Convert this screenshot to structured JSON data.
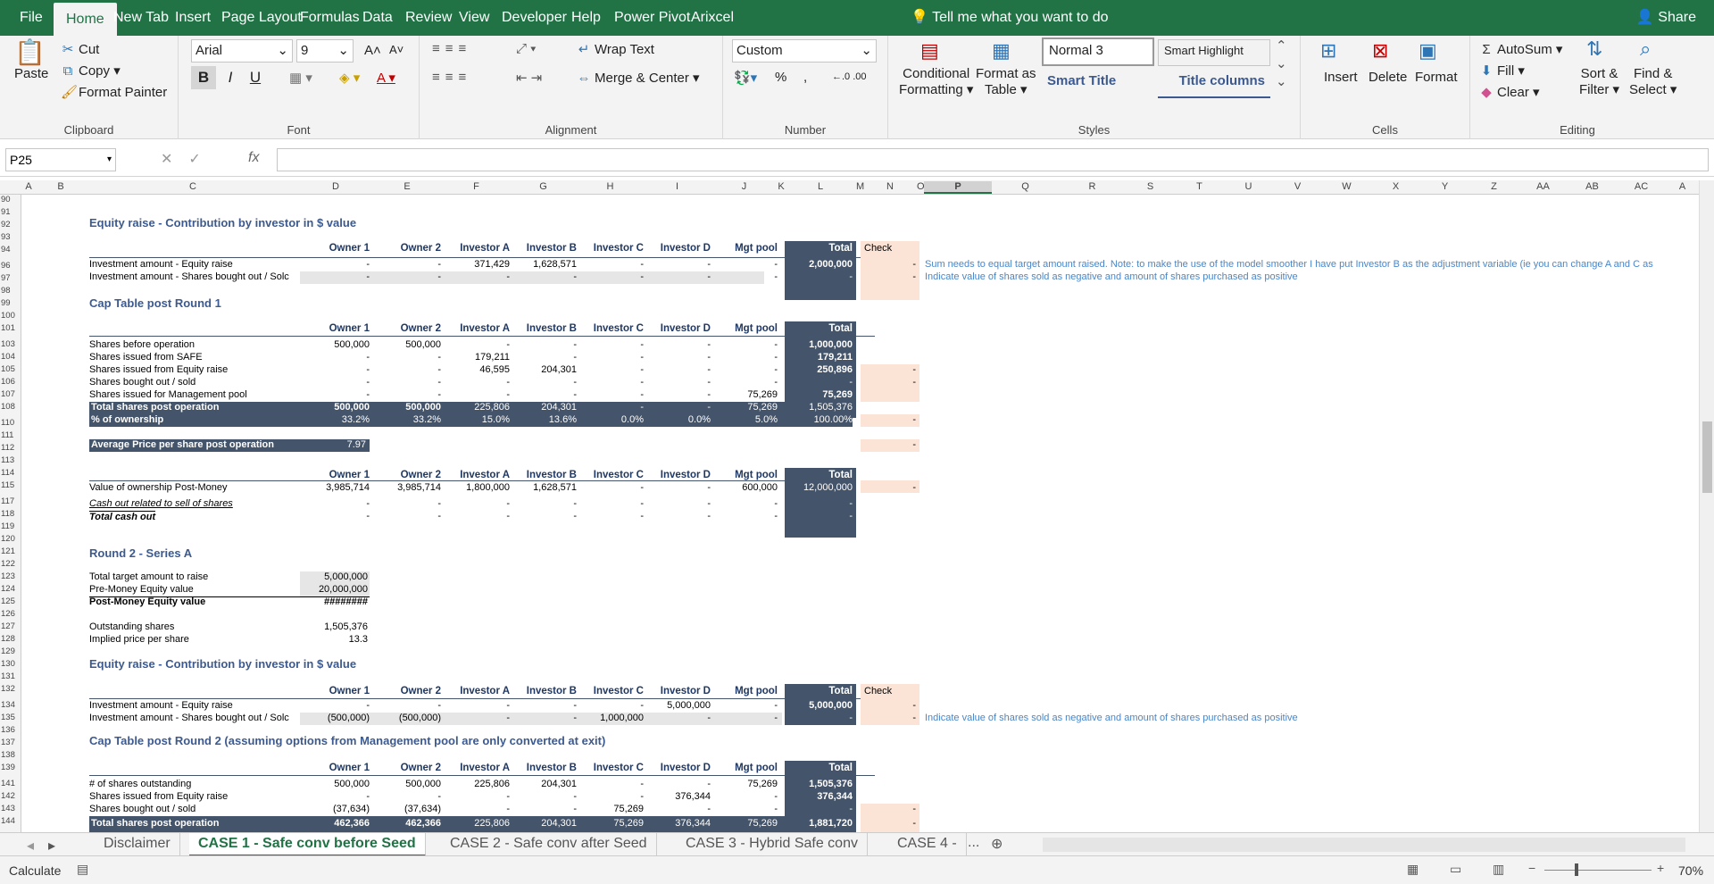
{
  "menubar": {
    "file": "File",
    "tabs": [
      "Home",
      "New Tab",
      "Insert",
      "Page Layout",
      "Formulas",
      "Data",
      "Review",
      "View",
      "Developer",
      "Help",
      "Power Pivot",
      "Arixcel"
    ],
    "tell_me": "Tell me what you want to do",
    "share": "Share"
  },
  "ribbon": {
    "clipboard": {
      "paste": "Paste",
      "cut": "Cut",
      "copy": "Copy",
      "format_painter": "Format Painter",
      "label": "Clipboard"
    },
    "font": {
      "name": "Arial",
      "size": "9",
      "label": "Font",
      "bold": "B",
      "italic": "I",
      "underline": "U"
    },
    "alignment": {
      "wrap": "Wrap Text",
      "merge": "Merge & Center",
      "label": "Alignment"
    },
    "number": {
      "format": "Custom",
      "percent": "%",
      "comma": ",",
      "label": "Number"
    },
    "styles": {
      "conditional": "Conditional",
      "conditional2": "Formatting",
      "format_as": "Format as",
      "format_as2": "Table",
      "normal3": "Normal 3",
      "smart_highlight": "Smart Highlight",
      "smart_title": "Smart Title",
      "title_columns": "Title columns",
      "label": "Styles"
    },
    "cells": {
      "insert": "Insert",
      "delete": "Delete",
      "format": "Format",
      "label": "Cells"
    },
    "editing": {
      "autosum": "AutoSum",
      "fill": "Fill",
      "clear": "Clear",
      "sort": "Sort &",
      "sort2": "Filter",
      "find": "Find &",
      "find2": "Select",
      "label": "Editing"
    }
  },
  "formula_bar": {
    "name_box": "P25",
    "fx": "fx",
    "value": ""
  },
  "columns": [
    "A",
    "B",
    "C",
    "D",
    "E",
    "F",
    "G",
    "H",
    "I",
    "J",
    "K",
    "L",
    "M",
    "N",
    "O",
    "P",
    "Q",
    "R",
    "S",
    "T",
    "U",
    "V",
    "W",
    "X",
    "Y",
    "Z",
    "AA",
    "AB",
    "AC",
    "A"
  ],
  "rows": [
    "90",
    "91",
    "92",
    "93",
    "94",
    "96",
    "97",
    "98",
    "99",
    "100",
    "101",
    "103",
    "104",
    "105",
    "106",
    "107",
    "108",
    "110",
    "111",
    "112",
    "113",
    "114",
    "115",
    "117",
    "118",
    "119",
    "120",
    "121",
    "122",
    "123",
    "124",
    "125",
    "126",
    "127",
    "128",
    "129",
    "130",
    "131",
    "132",
    "134",
    "135",
    "136",
    "137",
    "138",
    "139",
    "141",
    "142",
    "143",
    "144"
  ],
  "sheet": {
    "sec1": "Equity raise - Contribution by investor in $ value",
    "headers": [
      "Owner 1",
      "Owner 2",
      "Investor A",
      "Investor B",
      "Investor C",
      "Investor D",
      "Mgt pool",
      "Total",
      "Check"
    ],
    "r96_label": "Investment amount - Equity raise",
    "r96": [
      "-",
      "-",
      "371,429",
      "1,628,571",
      "-",
      "-",
      "-",
      "2,000,000",
      "-"
    ],
    "r97_label": "Investment amount - Shares bought out / Solc",
    "r97": [
      "-",
      "-",
      "-",
      "-",
      "-",
      "-",
      "-",
      "-",
      "-"
    ],
    "note96": "Sum needs to equal target amount raised. Note: to make the use of the model smoother I have put Investor B as the adjustment variable (ie you can change A and C as",
    "note97": "Indicate value of shares sold as negative and amount of shares purchased as positive",
    "sec2": "Cap Table post Round 1",
    "headers2": [
      "Owner 1",
      "Owner 2",
      "Investor A",
      "Investor B",
      "Investor C",
      "Investor D",
      "Mgt pool",
      "Total"
    ],
    "r103_label": "Shares before operation",
    "r103": [
      "500,000",
      "500,000",
      "-",
      "-",
      "-",
      "-",
      "-",
      "1,000,000"
    ],
    "r104_label": "Shares issued from SAFE",
    "r104": [
      "-",
      "-",
      "179,211",
      "-",
      "-",
      "-",
      "-",
      "179,211"
    ],
    "r105_label": "Shares issued from Equity raise",
    "r105": [
      "-",
      "-",
      "46,595",
      "204,301",
      "-",
      "-",
      "-",
      "250,896",
      "-"
    ],
    "r106_label": "Shares bought out / sold",
    "r106": [
      "-",
      "-",
      "-",
      "-",
      "-",
      "-",
      "-",
      "-",
      "-"
    ],
    "r107_label": "Shares issued for Management pool",
    "r107": [
      "-",
      "-",
      "-",
      "-",
      "-",
      "-",
      "75,269",
      "75,269"
    ],
    "r108_label": "Total shares post operation",
    "r108": [
      "500,000",
      "500,000",
      "225,806",
      "204,301",
      "-",
      "-",
      "75,269",
      "1,505,376"
    ],
    "r110_label": "% of ownership",
    "r110": [
      "33.2%",
      "33.2%",
      "15.0%",
      "13.6%",
      "0.0%",
      "0.0%",
      "5.0%",
      "100.00%",
      "-"
    ],
    "r112_label": "Average Price per share post operation",
    "r112_value": "7.97",
    "r112_check": "-",
    "r115_label": "Value of ownership Post-Money",
    "r115": [
      "3,985,714",
      "3,985,714",
      "1,800,000",
      "1,628,571",
      "-",
      "-",
      "600,000",
      "12,000,000",
      "-"
    ],
    "r117_label": "Cash out related to sell of shares",
    "r117": [
      "-",
      "-",
      "-",
      "-",
      "-",
      "-",
      "-",
      "-"
    ],
    "r118_label": "Total cash out",
    "r118": [
      "-",
      "-",
      "-",
      "-",
      "-",
      "-",
      "-",
      "-"
    ],
    "sec3": "Round 2 - Series A",
    "r123_label": "Total target amount to raise",
    "r123_value": "5,000,000",
    "r124_label": "Pre-Money Equity value",
    "r124_value": "20,000,000",
    "r125_label": "Post-Money Equity value",
    "r125_value": "########",
    "r127_label": "Outstanding shares",
    "r127_value": "1,505,376",
    "r128_label": "Implied price per share",
    "r128_value": "13.3",
    "sec4": "Equity raise - Contribution by investor in $ value",
    "r134_label": "Investment amount - Equity raise",
    "r134": [
      "-",
      "-",
      "-",
      "-",
      "-",
      "5,000,000",
      "-",
      "5,000,000",
      "-"
    ],
    "r135_label": "Investment amount - Shares bought out / Solc",
    "r135": [
      "(500,000)",
      "(500,000)",
      "-",
      "-",
      "1,000,000",
      "-",
      "-",
      "-",
      "-"
    ],
    "note135": "Indicate value of shares sold as negative and amount of shares purchased as positive",
    "sec5": "Cap Table post Round 2 (assuming options from Management pool are only converted at exit)",
    "r141_label": "# of shares outstanding",
    "r141": [
      "500,000",
      "500,000",
      "225,806",
      "204,301",
      "-",
      "-",
      "75,269",
      "1,505,376"
    ],
    "r142_label": "Shares issued from Equity raise",
    "r142": [
      "-",
      "-",
      "-",
      "-",
      "-",
      "376,344",
      "-",
      "376,344"
    ],
    "r143_label": "Shares bought out / sold",
    "r143": [
      "(37,634)",
      "(37,634)",
      "-",
      "-",
      "75,269",
      "-",
      "-",
      "-",
      "-"
    ],
    "r144_label": "Total shares post operation",
    "r144": [
      "462,366",
      "462,366",
      "225,806",
      "204,301",
      "75,269",
      "376,344",
      "75,269",
      "1,881,720",
      "-"
    ]
  },
  "sheet_tabs": [
    "Disclaimer",
    "CASE 1 - Safe conv before Seed",
    "CASE 2 - Safe conv after Seed",
    "CASE 3 - Hybrid Safe conv",
    "CASE 4 -",
    "..."
  ],
  "status": {
    "mode": "Calculate",
    "zoom": "70%"
  },
  "colors": {
    "brand": "#217346",
    "header_dark": "#44546a",
    "check_fill": "#fbe3d6",
    "note_blue": "#4a86c8"
  }
}
